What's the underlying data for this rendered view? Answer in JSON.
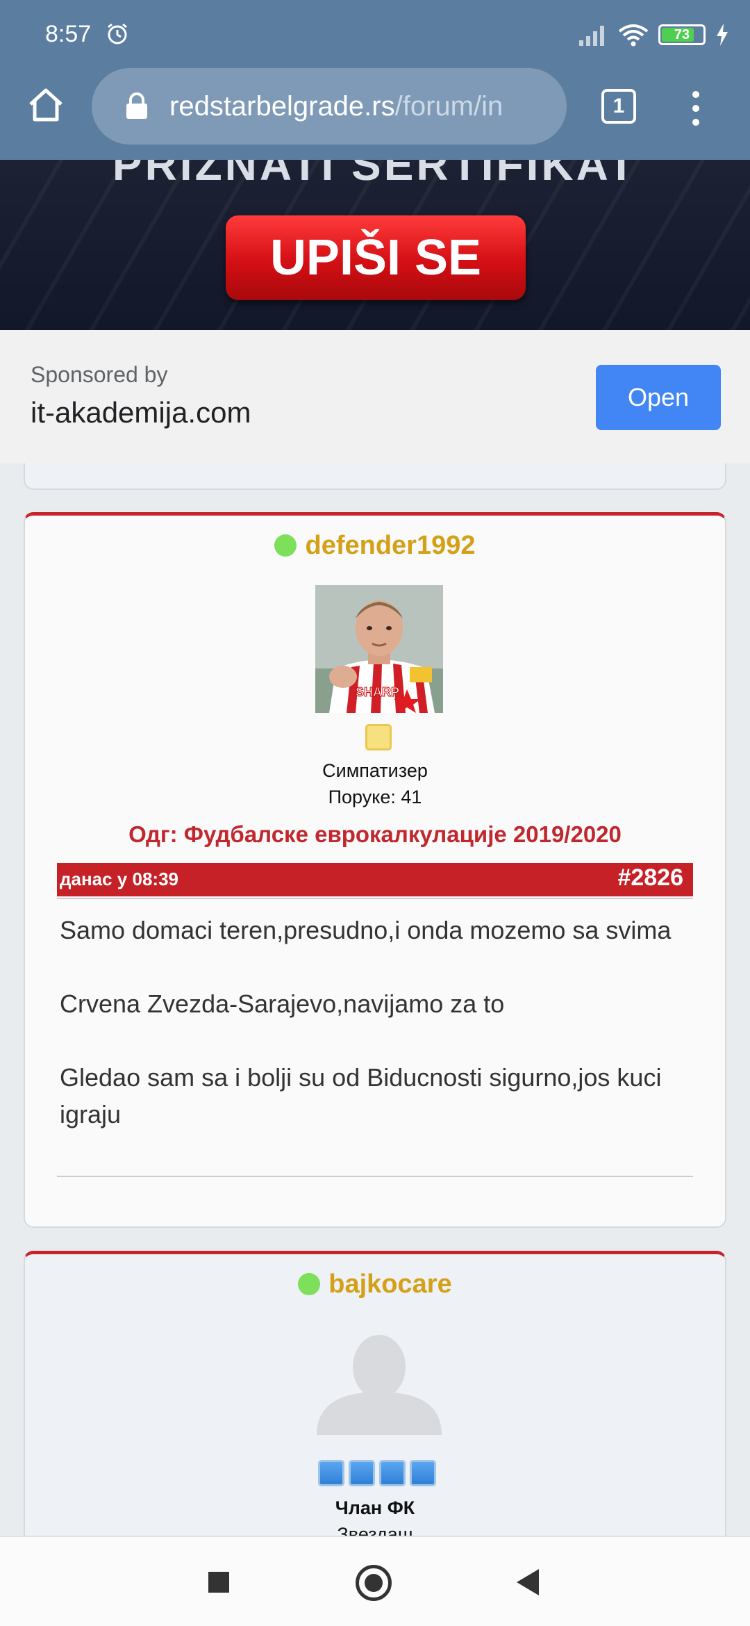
{
  "status_bar": {
    "time": "8:57",
    "battery": "73"
  },
  "browser": {
    "url_host": "redstarbelgrade.rs",
    "url_path": "/forum/in",
    "tab_count": "1"
  },
  "ad": {
    "top_text": "PRIZNATI SERTIFIKAT",
    "cta": "UPIŠI SE",
    "sponsored_by": "Sponsored by",
    "domain": "it-akademija.com",
    "open_label": "Open"
  },
  "posts": [
    {
      "username": "defender1992",
      "rank": "Симпатизер",
      "post_count": "Поруке: 41",
      "subject": "Одг: Фудбалске еврокалкулације 2019/2020",
      "date": "данас у 08:39",
      "number": "#2826",
      "body": [
        "Samo domaci teren,presudno,i onda mozemo sa svima",
        "Crvena Zvezda-Sarajevo,navijamo za to",
        "Gledao sam sa i bolji su od Biducnosti sigurno,jos kuci igraju"
      ]
    },
    {
      "username": "bajkocare",
      "rank": "Члан ФК",
      "subrank": "Звездаш"
    }
  ],
  "colors": {
    "chrome": "#5b7ea0",
    "username": "#d4a017",
    "accent_red": "#c62127",
    "online": "#7ee05a",
    "open_button": "#4285f4"
  }
}
